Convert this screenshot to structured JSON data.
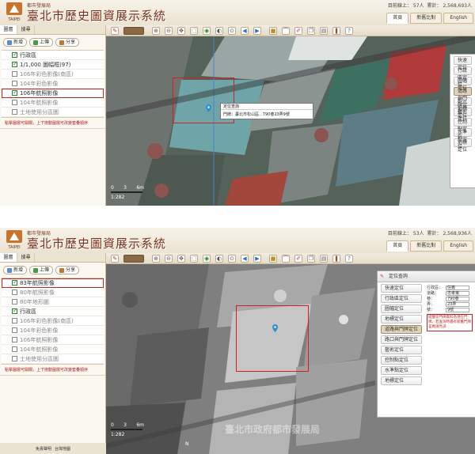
{
  "header": {
    "bureau": "都市發展局",
    "title": "臺北市歷史圖資展示系統",
    "version": "V1.2",
    "logo_text": "TAIPEI",
    "tabs": [
      "首頁",
      "新舊比對",
      "English"
    ]
  },
  "panel1": {
    "stats": {
      "today_label": "目前線上：",
      "today_value": "57人",
      "total_label": "累計：",
      "total_value": "2,568,693人"
    },
    "sidebar": {
      "tabs": [
        "圖層",
        "搜尋"
      ],
      "buttons": [
        "新增",
        "上傳",
        "分享"
      ],
      "layers": [
        {
          "label": "行政區",
          "checked": true
        },
        {
          "label": "1/1,000 圖幅框(97)",
          "checked": true
        },
        {
          "label": "106年彩色影像(南區)",
          "checked": false
        },
        {
          "label": "104年彩色影像",
          "checked": false
        },
        {
          "label": "106年航照影像",
          "checked": true
        },
        {
          "label": "104年航照影像",
          "checked": false
        },
        {
          "label": "土地使用分區圖",
          "checked": false
        }
      ],
      "hint": "點擊圖層可開關，上下拖動圖層可改變套疊順序"
    },
    "popup": {
      "title": "定位查詢",
      "text": "門牌：臺北市松山區...790巷23弄9號"
    },
    "locate_menu": [
      "快速定位",
      "行政區定位",
      "圖幅定位",
      "道路與門牌定位",
      "觀光地標定位",
      "藝術定位",
      "控制點定位",
      "水準點定位",
      "地標定位"
    ],
    "scale": {
      "label": "6m",
      "ratio": "1:282"
    }
  },
  "panel2": {
    "stats": {
      "today_label": "目前線上：",
      "today_value": "53人",
      "total_label": "累計：",
      "total_value": "2,568,936人"
    },
    "sidebar": {
      "tabs": [
        "圖層",
        "搜尋"
      ],
      "buttons": [
        "新增",
        "上傳",
        "分享"
      ],
      "layers": [
        {
          "label": "83年航照影像",
          "checked": true
        },
        {
          "label": "80年航照影像",
          "checked": false
        },
        {
          "label": "80年地形圖",
          "checked": false
        },
        {
          "label": "行政區",
          "checked": true
        },
        {
          "label": "106年彩色影像(南區)",
          "checked": false
        },
        {
          "label": "104年彩色影像",
          "checked": false
        },
        {
          "label": "106年航照影像",
          "checked": false
        },
        {
          "label": "104年航照影像",
          "checked": false
        },
        {
          "label": "土地使用分區圖",
          "checked": false
        }
      ],
      "hint": "點擊圖層可開關，上下拖動圖層可改變套疊順序",
      "footer": [
        "免責聲明",
        "台灣地圖"
      ]
    },
    "locate_panel": {
      "title": "定位查詢",
      "menu": [
        "快速定位",
        "行政區定位",
        "圖幅定位",
        "地標定位",
        "道路與門牌定位",
        "路口與門牌定位",
        "藝術定位",
        "控制點定位",
        "水準點定位",
        "地標定位"
      ],
      "form": [
        {
          "key": "行政區：",
          "value": "信義"
        },
        {
          "key": "道路：",
          "value": "忠孝東"
        },
        {
          "key": "巷：",
          "value": "790巷"
        },
        {
          "key": "弄：",
          "value": "23弄"
        },
        {
          "key": "號：",
          "value": "9號"
        }
      ],
      "warning": "提醒您門牌資料為現在門牌，若查詢時遇有新舊門牌差異請見諒"
    },
    "watermark": "臺北市政府都市發展局",
    "north_label": "N",
    "scale": {
      "label": "6m",
      "ratio": "1:282"
    }
  }
}
